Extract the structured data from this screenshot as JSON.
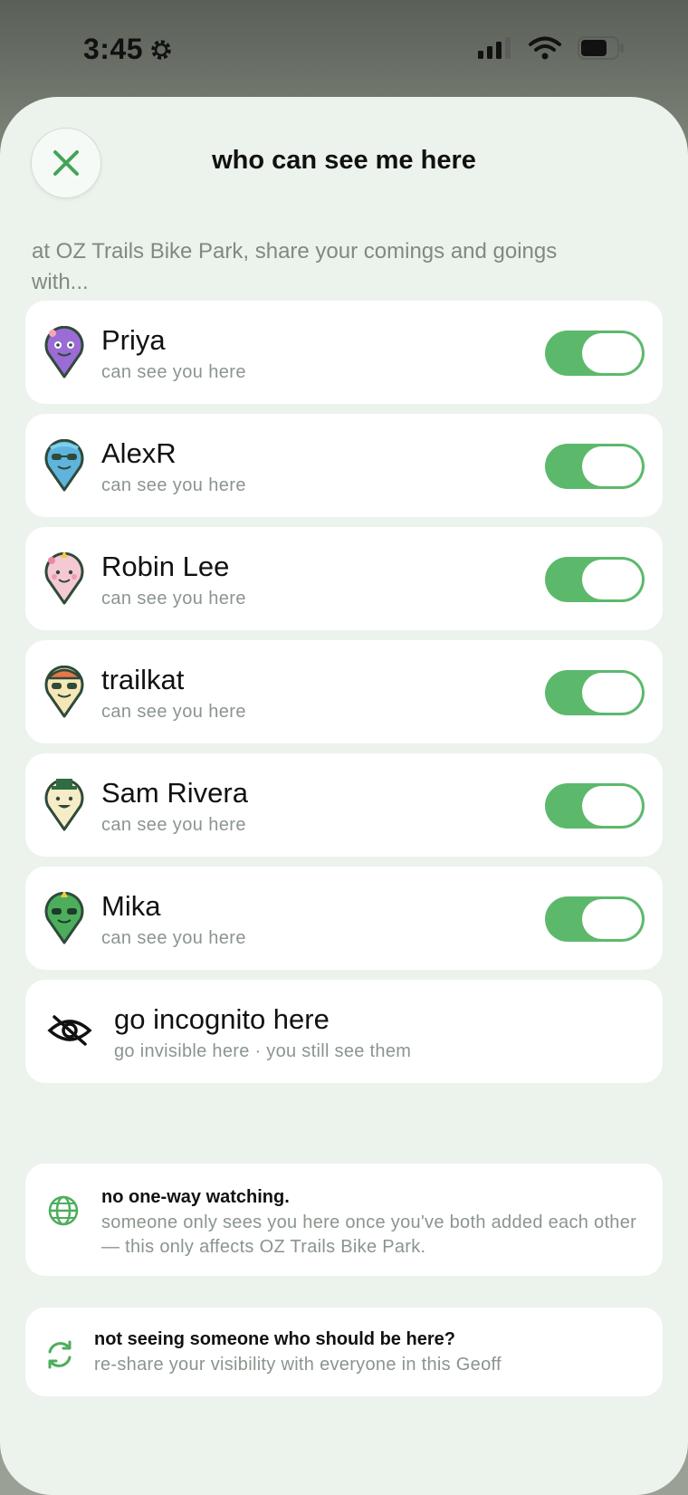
{
  "status_bar": {
    "time": "3:45",
    "icons": [
      "gear-icon",
      "cellular-signal-icon",
      "wifi-icon",
      "battery-icon"
    ]
  },
  "sheet": {
    "title": "who can see me here",
    "close_icon": "close-icon",
    "intro": "at OZ Trails Bike Park, share your comings and goings with..."
  },
  "people": [
    {
      "name": "Priya",
      "status": "can see you here",
      "enabled": true,
      "avatar": "purple-pin-avatar",
      "color": "#9b6bd6"
    },
    {
      "name": "AlexR",
      "status": "can see you here",
      "enabled": true,
      "avatar": "blue-pin-avatar",
      "color": "#5fb4dd"
    },
    {
      "name": "Robin Lee",
      "status": "can see you here",
      "enabled": true,
      "avatar": "pink-pin-avatar",
      "color": "#f5c9d3"
    },
    {
      "name": "trailkat",
      "status": "can see you here",
      "enabled": true,
      "avatar": "helmet-pin-avatar",
      "color": "#f6e7b8"
    },
    {
      "name": "Sam Rivera",
      "status": "can see you here",
      "enabled": true,
      "avatar": "tophat-pin-avatar",
      "color": "#f6ecc8"
    },
    {
      "name": "Mika",
      "status": "can see you here",
      "enabled": true,
      "avatar": "green-pin-avatar",
      "color": "#4cae5c"
    }
  ],
  "incognito": {
    "title": "go incognito here",
    "subtitle": "go invisible here · you still see them",
    "icon": "eye-slash-icon"
  },
  "info": {
    "title": "no one-way watching.",
    "body": "someone only sees you here once you've both added each other — this only affects OZ Trails Bike Park.",
    "icon": "globe-icon"
  },
  "reshare": {
    "title": "not seeing someone who should be here?",
    "subtitle": "re-share your visibility with everyone in this Geoff",
    "icon": "refresh-icon"
  },
  "colors": {
    "sheet_bg": "#ebf3ec",
    "toggle_on": "#5cb96c",
    "accent_green": "#4cae5c",
    "avatar_outline": "#2f4a39"
  }
}
